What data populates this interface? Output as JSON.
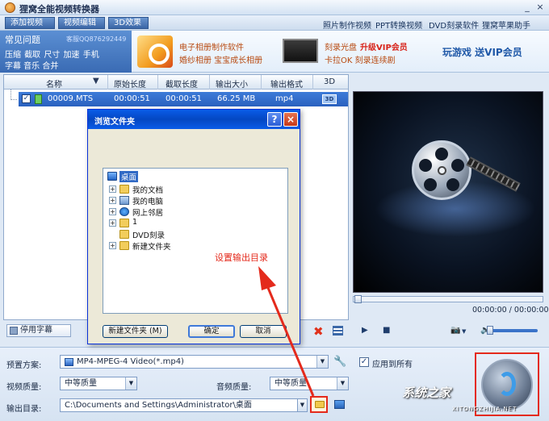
{
  "window": {
    "title": "狸窝全能视频转换器",
    "minimize": "_",
    "close": "×"
  },
  "toolbar": {
    "add_video": "添加视频",
    "edit_video": "视频编辑",
    "effects_3d": "3D效果",
    "links": [
      "照片制作视频",
      "PPT转换视频",
      "DVD刻录软件",
      "狸窝苹果助手"
    ]
  },
  "faq": {
    "title": "常见问题",
    "qq": "客服QQ876292449",
    "line1": "压缩 截取 尺寸 加速 手机",
    "line2": "字幕 音乐 合并"
  },
  "promos": {
    "album_software": "电子相册制作软件",
    "wedding_album": "婚纱相册 宝宝成长相册",
    "burn_disc": "刻录光盘",
    "upgrade_vip": "升级VIP会员",
    "karaoke": "卡拉OK 刻录连续剧",
    "play_game": "玩游戏 送VIP会员"
  },
  "file_list": {
    "headers": [
      "名称",
      "原始长度",
      "截取长度",
      "输出大小",
      "输出格式",
      "3D"
    ],
    "sort_arrow": "▼",
    "rows": [
      {
        "checked": "✓",
        "name": "00009.MTS",
        "original_length": "00:00:51",
        "clip_length": "00:00:51",
        "output_size": "66.25 MB",
        "output_format": "mp4",
        "badge_3d": "3D"
      }
    ]
  },
  "preview": {
    "time": "00:00:00 / 00:00:00"
  },
  "player_controls": {
    "play": "▶",
    "stop": "■",
    "camera": "📷",
    "camera_dropdown": "▼",
    "volume": "🔈"
  },
  "list_footer": {
    "disable_subtitles": "停用字幕",
    "delete": "✖"
  },
  "settings": {
    "preset_label": "预置方案:",
    "preset_value": "MP4-MPEG-4 Video(*.mp4)",
    "apply_all_checked": "✓",
    "apply_all_label": "应用到所有",
    "video_quality_label": "视频质量:",
    "video_quality_value": "中等质量",
    "audio_quality_label": "音频质量:",
    "audio_quality_value": "中等质量",
    "output_dir_label": "输出目录:",
    "output_dir_value": "C:\\Documents and Settings\\Administrator\\桌面",
    "tool_icon": "🔧",
    "dropdown_arrow": "▼"
  },
  "dialog": {
    "title": "浏览文件夹",
    "help": "?",
    "close": "×",
    "tree": [
      {
        "label": "桌面"
      },
      {
        "expander": "+",
        "label": "我的文档"
      },
      {
        "expander": "+",
        "label": "我的电脑"
      },
      {
        "expander": "+",
        "label": "网上邻居"
      },
      {
        "expander": "+",
        "label": "1"
      },
      {
        "label": "DVD刻录"
      },
      {
        "expander": "+",
        "label": "新建文件夹"
      }
    ],
    "new_folder": "新建文件夹 (M)",
    "ok": "确定",
    "cancel": "取消"
  },
  "annotation": {
    "text": "设置输出目录",
    "color": "#e42a1c"
  },
  "watermark": {
    "text": "系统之家",
    "sub": "XITONGZHIJIA.NET"
  }
}
